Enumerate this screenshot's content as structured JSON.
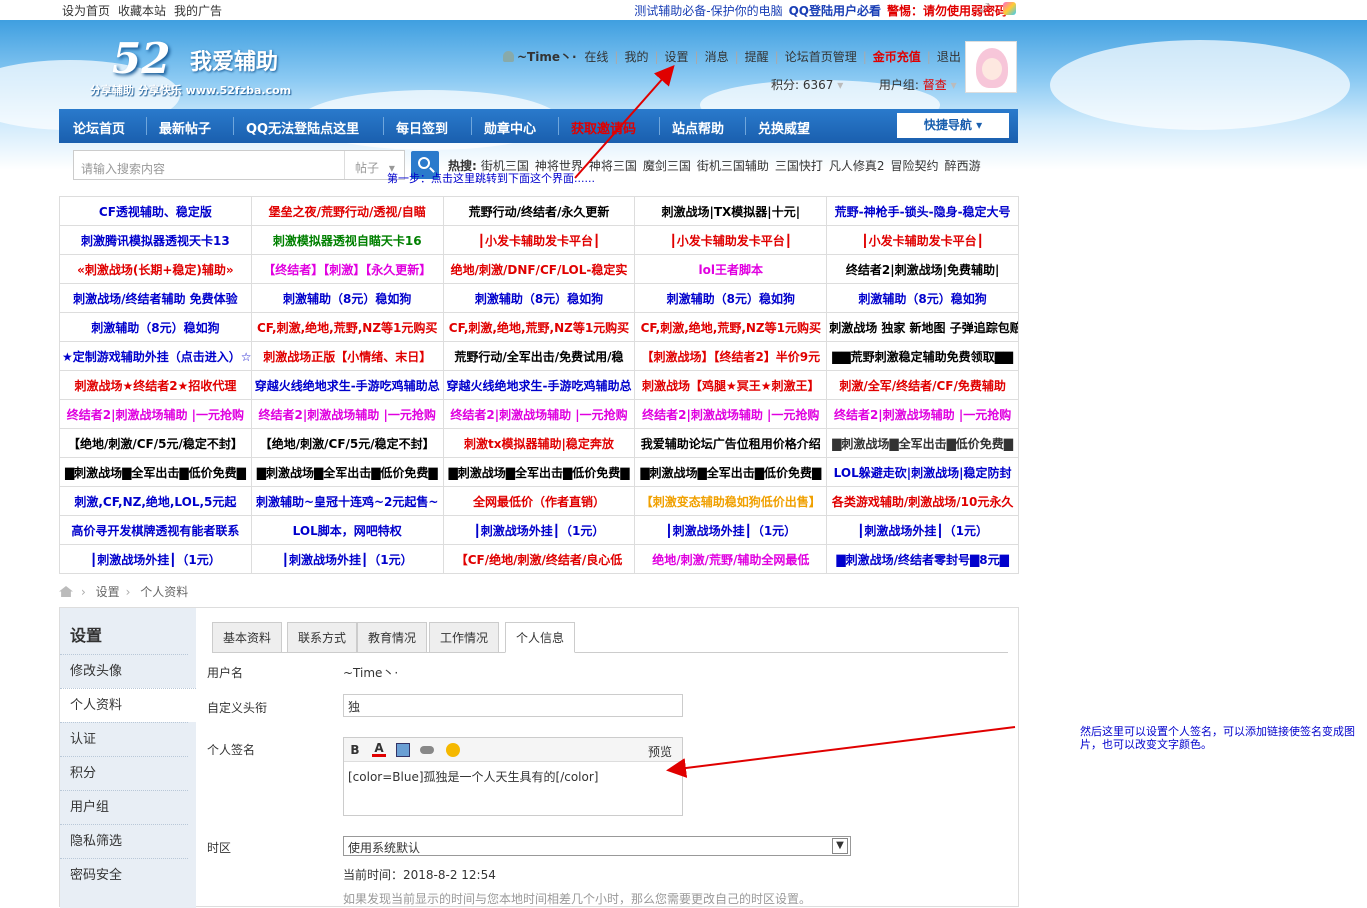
{
  "topbar": {
    "left": [
      "设为首页",
      "收藏本站",
      "我的广告"
    ],
    "right": [
      {
        "text": "测试辅助必备-保护你的电脑",
        "color": "#1a3fb5"
      },
      {
        "text": "QQ登陆用户必看",
        "color": "#1a3fb5"
      },
      {
        "text": "警惕：请勿使用弱密码",
        "color": "#e00000"
      }
    ]
  },
  "logo": {
    "num": "52",
    "name": "我爱辅助",
    "slogan": "分享辅助  分享快乐  www.52fzba.com"
  },
  "user": {
    "name": "~Time丶·",
    "items": [
      "在线",
      "我的",
      "设置",
      "消息",
      "提醒",
      "论坛首页管理",
      "金币充值",
      "退出"
    ],
    "points": "积分: 6367",
    "group": "用户组: ",
    "group_value": "督查"
  },
  "nav": {
    "items": [
      "论坛首页",
      "最新帖子",
      "QQ无法登陆点这里",
      "每日签到",
      "勋章中心",
      "获取邀请码",
      "站点帮助",
      "兑换威望"
    ],
    "quick": "快捷导航"
  },
  "search": {
    "placeholder": "请输入搜索内容",
    "select": "帖子",
    "hot_label": "热搜:",
    "hot": [
      "街机三国",
      "神将世界",
      "神将三国",
      "魔剑三国",
      "街机三国辅助",
      "三国快打",
      "凡人修真2",
      "冒险契约",
      "醉西游"
    ]
  },
  "annotations": {
    "step1": "第一步：点击这里跳转到下面这个界面......",
    "step2": "然后这里可以设置个人签名，可以添加链接使签名变成图片，也可以改变文字颜色。"
  },
  "ads": [
    [
      {
        "t": "CF透视辅助、稳定版",
        "c": "#0000cc"
      },
      {
        "t": "堡垒之夜/荒野行动/透视/自瞄",
        "c": "#e00000"
      },
      {
        "t": "荒野行动/终结者/永久更新",
        "c": "#000"
      },
      {
        "t": "刺激战场|TX模拟器|十元|",
        "c": "#000"
      },
      {
        "t": "荒野-神枪手-锁头-隐身-稳定大号",
        "c": "#0000cc"
      }
    ],
    [
      {
        "t": "刺激腾讯模拟器透视天卡13",
        "c": "#0000cc"
      },
      {
        "t": "刺激模拟器透视自瞄天卡16",
        "c": "#008000"
      },
      {
        "t": "┃小发卡辅助发卡平台┃",
        "c": "#e00000"
      },
      {
        "t": "┃小发卡辅助发卡平台┃",
        "c": "#e00000"
      },
      {
        "t": "┃小发卡辅助发卡平台┃",
        "c": "#e00000"
      }
    ],
    [
      {
        "t": "«刺激战场(长期+稳定)辅助»",
        "c": "#e00000"
      },
      {
        "t": "【终结者】【刺激】【永久更新】",
        "c": "#e000e0"
      },
      {
        "t": "绝地/刺激/DNF/CF/LOL-稳定实",
        "c": "#e00000"
      },
      {
        "t": "lol王者脚本",
        "c": "#e000e0"
      },
      {
        "t": "终结者2|刺激战场|免费辅助|",
        "c": "#000"
      }
    ],
    [
      {
        "t": "刺激战场/终结者辅助 免费体验",
        "c": "#0000cc"
      },
      {
        "t": "刺激辅助（8元）稳如狗",
        "c": "#0000cc"
      },
      {
        "t": "刺激辅助（8元）稳如狗",
        "c": "#0000cc"
      },
      {
        "t": "刺激辅助（8元）稳如狗",
        "c": "#0000cc"
      },
      {
        "t": "刺激辅助（8元）稳如狗",
        "c": "#0000cc"
      }
    ],
    [
      {
        "t": "刺激辅助（8元）稳如狗",
        "c": "#0000cc"
      },
      {
        "t": "CF,刺激,绝地,荒野,NZ等1元购买",
        "c": "#e00000"
      },
      {
        "t": "CF,刺激,绝地,荒野,NZ等1元购买",
        "c": "#e00000"
      },
      {
        "t": "CF,刺激,绝地,荒野,NZ等1元购买",
        "c": "#e00000"
      },
      {
        "t": "刺激战场 独家 新地图 子弹追踪包赔",
        "c": "#000"
      }
    ],
    [
      {
        "t": "★定制游戏辅助外挂（点击进入）☆",
        "c": "#0000cc"
      },
      {
        "t": "刺激战场正版【小情绪、末日】",
        "c": "#e00000"
      },
      {
        "t": "荒野行动/全军出击/免费试用/稳",
        "c": "#000"
      },
      {
        "t": "【刺激战场】【终结者2】半价9元",
        "c": "#e00000"
      },
      {
        "t": "▇▇荒野刺激稳定辅助免费领取▇▇",
        "c": "#000"
      }
    ],
    [
      {
        "t": "刺激战场★终结者2★招收代理",
        "c": "#e00000"
      },
      {
        "t": "穿越火线绝地求生-手游吃鸡辅助总",
        "c": "#0000cc"
      },
      {
        "t": "穿越火线绝地求生-手游吃鸡辅助总",
        "c": "#0000cc"
      },
      {
        "t": "刺激战场【鸡腿★冥王★刺激王】",
        "c": "#e00000"
      },
      {
        "t": "刺激/全军/终结者/CF/免费辅助",
        "c": "#e00000"
      }
    ],
    [
      {
        "t": "终结者2|刺激战场辅助 |一元抢购",
        "c": "#e000e0"
      },
      {
        "t": "终结者2|刺激战场辅助 |一元抢购",
        "c": "#e000e0"
      },
      {
        "t": "终结者2|刺激战场辅助 |一元抢购",
        "c": "#e000e0"
      },
      {
        "t": "终结者2|刺激战场辅助 |一元抢购",
        "c": "#e000e0"
      },
      {
        "t": "终结者2|刺激战场辅助 |一元抢购",
        "c": "#e000e0"
      }
    ],
    [
      {
        "t": "【绝地/刺激/CF/5元/稳定不封】",
        "c": "#000"
      },
      {
        "t": "【绝地/刺激/CF/5元/稳定不封】",
        "c": "#000"
      },
      {
        "t": "刺激tx模拟器辅助|稳定奔放",
        "c": "#e00000"
      },
      {
        "t": "我爱辅助论坛广告位租用价格介绍",
        "c": "#000"
      },
      {
        "t": "▇刺激战场▇全军出击▇低价免费▇",
        "c": "#333"
      }
    ],
    [
      {
        "t": "▇刺激战场▇全军出击▇低价免费▇",
        "c": "#000"
      },
      {
        "t": "▇刺激战场▇全军出击▇低价免费▇",
        "c": "#000"
      },
      {
        "t": "▇刺激战场▇全军出击▇低价免费▇",
        "c": "#000"
      },
      {
        "t": "▇刺激战场▇全军出击▇低价免费▇",
        "c": "#000"
      },
      {
        "t": "LOL躲避走砍|刺激战场|稳定防封",
        "c": "#0000cc"
      }
    ],
    [
      {
        "t": "刺激,CF,NZ,绝地,LOL,5元起",
        "c": "#0000cc"
      },
      {
        "t": "刺激辅助~皇冠十连鸡~2元起售~",
        "c": "#0000cc"
      },
      {
        "t": "全网最低价（作者直销）",
        "c": "#e00000"
      },
      {
        "t": "【刺激变态辅助稳如狗低价出售】",
        "c": "#f0a000"
      },
      {
        "t": "各类游戏辅助/刺激战场/10元永久",
        "c": "#e00000"
      }
    ],
    [
      {
        "t": "高价寻开发棋牌透视有能者联系",
        "c": "#0000cc"
      },
      {
        "t": "LOL脚本，网吧特权",
        "c": "#0000cc"
      },
      {
        "t": "┃刺激战场外挂┃（1元）",
        "c": "#0000cc"
      },
      {
        "t": "┃刺激战场外挂┃（1元）",
        "c": "#0000cc"
      },
      {
        "t": "┃刺激战场外挂┃（1元）",
        "c": "#0000cc"
      }
    ],
    [
      {
        "t": "┃刺激战场外挂┃（1元）",
        "c": "#0000cc"
      },
      {
        "t": "┃刺激战场外挂┃（1元）",
        "c": "#0000cc"
      },
      {
        "t": "【CF/绝地/刺激/终结者/良心低",
        "c": "#e00000"
      },
      {
        "t": "绝地/刺激/荒野/辅助全网最低",
        "c": "#e000e0"
      },
      {
        "t": "▇刺激战场/终结者零封号▇8元▇",
        "c": "#0000cc"
      }
    ]
  ],
  "breadcrumb": [
    "设置",
    "个人资料"
  ],
  "sidebar": {
    "title": "设置",
    "items": [
      "修改头像",
      "个人资料",
      "认证",
      "积分",
      "用户组",
      "隐私筛选",
      "密码安全"
    ],
    "active": 1
  },
  "tabs": {
    "items": [
      "基本资料",
      "联系方式",
      "教育情况",
      "工作情况",
      "个人信息"
    ],
    "active": 4
  },
  "form": {
    "username_label": "用户名",
    "username_value": "~Time丶·",
    "title_label": "自定义头衔",
    "title_value": "独",
    "sig_label": "个人签名",
    "sig_preview": "预览",
    "sig_value": "[color=Blue]孤独是一个人天生具有的[/color]",
    "tz_label": "时区",
    "tz_value": "使用系统默认",
    "now": "当前时间：2018-8-2 12:54",
    "hint": "如果发现当前显示的时间与您本地时间相差几个小时，那么您需要更改自己的时区设置。"
  },
  "colors": {
    "nav": "#1a5fae",
    "accent_red": "#e00000",
    "link_blue": "#0000cc",
    "arrow": "#e00000"
  }
}
